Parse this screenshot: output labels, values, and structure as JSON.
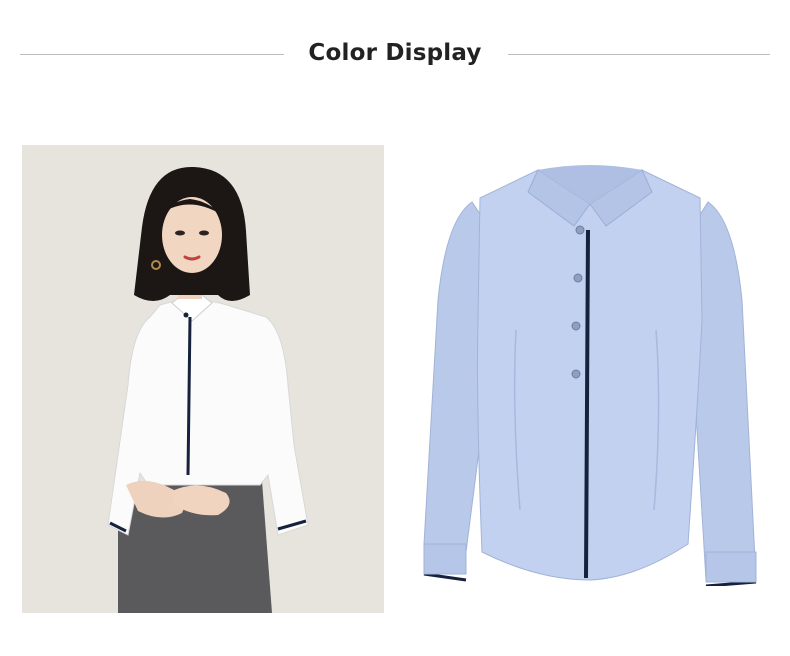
{
  "header": {
    "title": "Color Display"
  },
  "colors": {
    "title_text": "#222222",
    "divider": "#bdbdbd",
    "photo_background": "#e6e4dc",
    "white_shirt": "#fbfbfb",
    "blue_shirt": "#b9c9ea",
    "piping": "#16213d",
    "trousers": "#5a5a5c"
  },
  "images": [
    {
      "name": "model-photo-white-shirt"
    },
    {
      "name": "product-photo-blue-shirt"
    }
  ]
}
